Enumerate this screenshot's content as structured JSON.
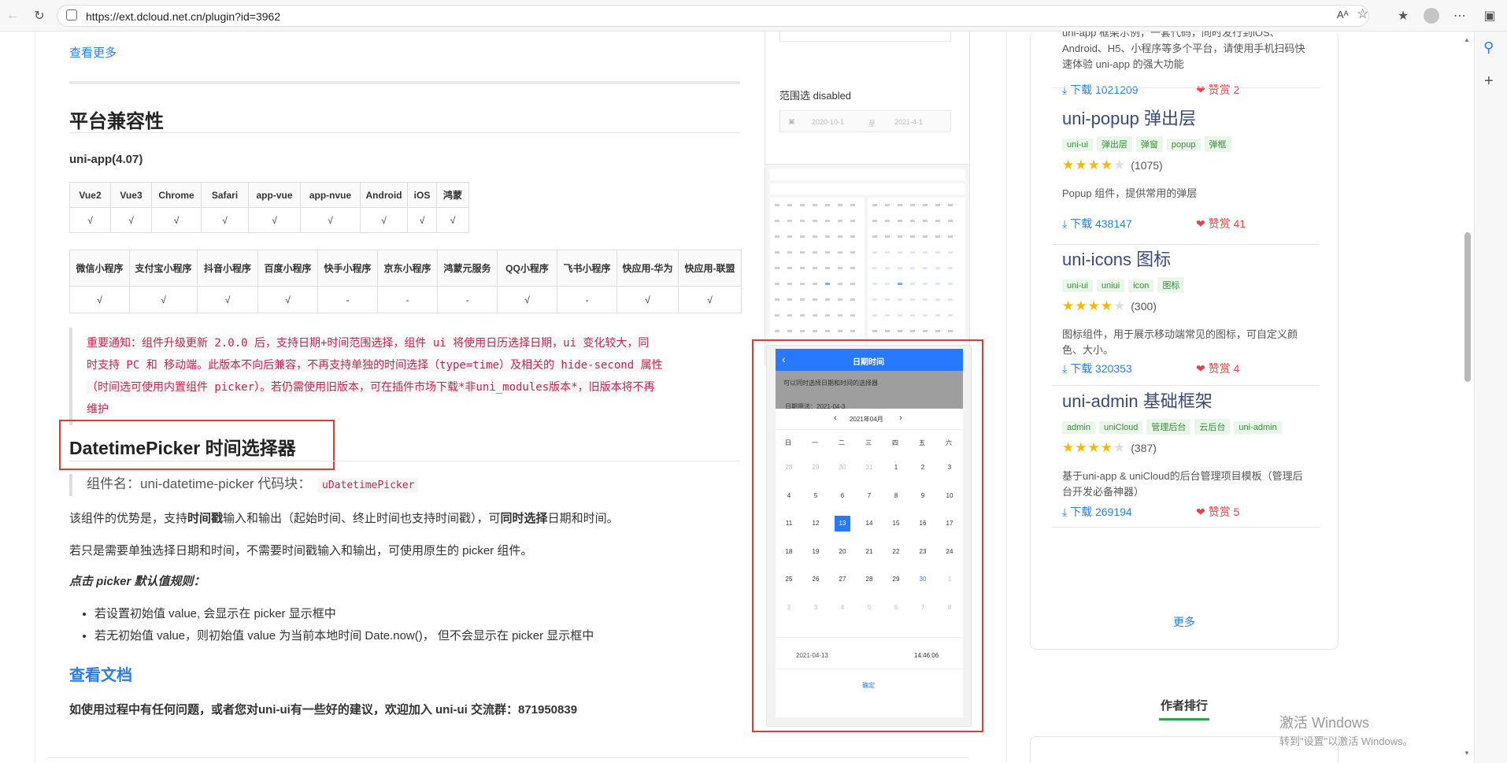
{
  "browser": {
    "url": "https://ext.dcloud.net.cn/plugin?id=3962",
    "read_aloud": "Aᴬ"
  },
  "main": {
    "more_link": "查看更多",
    "compat_title": "平台兼容性",
    "uniapp_version": "uni-app(4.07)",
    "table1": {
      "headers": [
        "Vue2",
        "Vue3",
        "Chrome",
        "Safari",
        "app-vue",
        "app-nvue",
        "Android",
        "iOS",
        "鸿蒙"
      ],
      "values": [
        "√",
        "√",
        "√",
        "√",
        "√",
        "√",
        "√",
        "√",
        "√"
      ]
    },
    "table2": {
      "headers": [
        "微信小程序",
        "支付宝小程序",
        "抖音小程序",
        "百度小程序",
        "快手小程序",
        "京东小程序",
        "鸿蒙元服务",
        "QQ小程序",
        "飞书小程序",
        "快应用-华为",
        "快应用-联盟"
      ],
      "values": [
        "√",
        "√",
        "√",
        "√",
        "-",
        "-",
        "-",
        "√",
        "-",
        "√",
        "√"
      ]
    },
    "notice_lines": [
      "重要通知：组件升级更新 2.0.0 后，支持日期+时间范围选择，组件 ui 将使用日历选择日期，ui 变化较大，同",
      "时支持 PC 和 移动端。此版本不向后兼容，不再支持单独的时间选择（type=time）及相关的 hide-second 属性",
      "（时间选可使用内置组件 picker）。若仍需使用旧版本，可在插件市场下载*非uni_modules版本*，旧版本将不再",
      "维护"
    ],
    "component_title": "DatetimePicker 时间选择器",
    "component_name_prefix": "组件名：uni-datetime-picker 代码块：",
    "component_code": "uDatetimePicker",
    "desc_parts": [
      "该组件的优势是，支持",
      "时间戳",
      "输入和输出（起始时间、终止时间也支持时间戳），可",
      "同时选择",
      "日期和时间。"
    ],
    "desc2": "若只是需要单独选择日期和时间，不需要时间戳输入和输出，可使用原生的 picker 组件。",
    "rule_title": "点击 picker 默认值规则：",
    "rules": [
      "若设置初始值 value, 会显示在 picker 显示框中",
      "若无初始值 value，则初始值 value 为当前本地时间 Date.now()， 但不会显示在 picker 显示框中"
    ],
    "doc_link": "查看文档",
    "contact": "如使用过程中有任何问题，或者您对uni-ui有一些好的建议，欢迎加入 uni-ui 交流群：871950839"
  },
  "screenshot1": {
    "label": "范围选 disabled",
    "start": "2020-10-1",
    "to": "至",
    "end": "2021-4-1"
  },
  "screenshot3": {
    "header": "日期时间",
    "subtitle": "可以同时选择日期和时间的选择器",
    "usage": "日期用法：2021-04-3",
    "month": "2021年04月",
    "weekdays": [
      "日",
      "一",
      "二",
      "三",
      "四",
      "五",
      "六"
    ],
    "days": [
      [
        "28",
        "29",
        "30",
        "31",
        "1",
        "2",
        "3"
      ],
      [
        "4",
        "5",
        "6",
        "7",
        "8",
        "9",
        "10"
      ],
      [
        "11",
        "12",
        "13",
        "14",
        "15",
        "16",
        "17"
      ],
      [
        "18",
        "19",
        "20",
        "21",
        "22",
        "23",
        "24"
      ],
      [
        "25",
        "26",
        "27",
        "28",
        "29",
        "30",
        "1"
      ],
      [
        "2",
        "3",
        "4",
        "5",
        "6",
        "7",
        "8"
      ]
    ],
    "selected_day": "13",
    "date_value": "2021-04-13",
    "time_value": "14:46:06",
    "confirm": "确定"
  },
  "sidebar": {
    "top_desc": "uni-app 框架示例，一套代码，同时发行到iOS、Android、H5、小程序等多个平台，请使用手机扫码快速体验 uni-app 的强大功能",
    "top_download": "下载 1021209",
    "top_like": "赞赏 2",
    "plugins": [
      {
        "title": "uni-popup 弹出层",
        "tags": [
          "uni-ui",
          "弹出层",
          "弹窗",
          "popup",
          "弹框"
        ],
        "rating": 3.5,
        "count": "(1075)",
        "desc": "Popup 组件，提供常用的弹层",
        "download": "下载 438147",
        "like": "赞赏 41"
      },
      {
        "title": "uni-icons 图标",
        "tags": [
          "uni-ui",
          "uniui",
          "icon",
          "图标"
        ],
        "rating": 3.5,
        "count": "(300)",
        "desc": "图标组件，用于展示移动端常见的图标，可自定义颜色、大小。",
        "download": "下载 320353",
        "like": "赞赏 4"
      },
      {
        "title": "uni-admin 基础框架",
        "tags": [
          "admin",
          "uniCloud",
          "管理后台",
          "云后台",
          "uni-admin"
        ],
        "rating": 4,
        "count": "(387)",
        "desc": "基于uni-app & uniCloud的后台管理项目模板（管理后台开发必备神器）",
        "download": "下载 269194",
        "like": "赞赏 5"
      }
    ],
    "more": "更多",
    "author_rank": "作者排行"
  },
  "watermark": {
    "line1": "激活 Windows",
    "line2": "转到\"设置\"以激活 Windows。"
  },
  "colors": {
    "accent": "#2b7de9",
    "red_highlight": "#e53935",
    "picker_blue": "#2979ff",
    "like_red": "#e64343"
  }
}
